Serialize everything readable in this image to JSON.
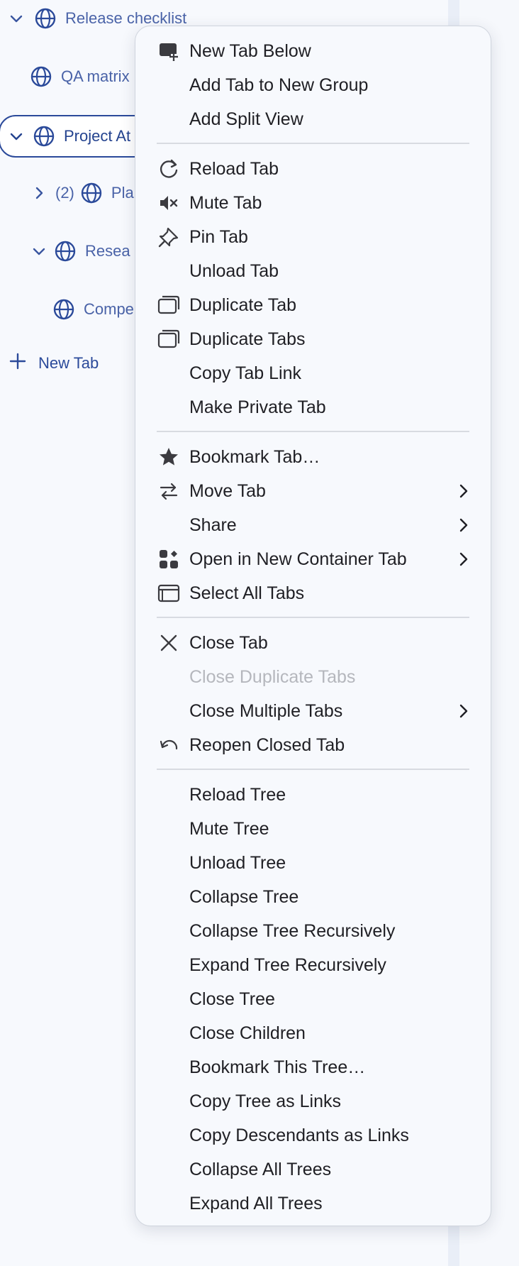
{
  "sidebar": {
    "items": [
      {
        "label": "Release checklist",
        "count": "",
        "expanded": true
      },
      {
        "label": "QA matrix",
        "count": ""
      },
      {
        "label": "Project At",
        "count": "",
        "expanded": true
      },
      {
        "label": "Pla",
        "count": "(2)",
        "expanded": false
      },
      {
        "label": "Resea",
        "count": "",
        "expanded": true
      },
      {
        "label": "Compe",
        "count": ""
      }
    ],
    "new_tab_label": "New Tab"
  },
  "menu": {
    "groups": [
      [
        "New Tab Below",
        "Add Tab to New Group",
        "Add Split View"
      ],
      [
        "Reload Tab",
        "Mute Tab",
        "Pin Tab",
        "Unload Tab",
        "Duplicate Tab",
        "Duplicate Tabs",
        "Copy Tab Link",
        "Make Private Tab"
      ],
      [
        "Bookmark Tab…",
        "Move Tab",
        "Share",
        "Open in New Container Tab",
        "Select All Tabs"
      ],
      [
        "Close Tab",
        "Close Duplicate Tabs",
        "Close Multiple Tabs",
        "Reopen Closed Tab"
      ],
      [
        "Reload Tree",
        "Mute Tree",
        "Unload Tree",
        "Collapse Tree",
        "Collapse Tree Recursively",
        "Expand Tree Recursively",
        "Close Tree",
        "Close Children",
        "Bookmark This Tree…",
        "Copy Tree as Links",
        "Copy Descendants as Links",
        "Collapse All Trees",
        "Expand All Trees"
      ]
    ],
    "disabled_item": "Close Duplicate Tabs",
    "submenu_items": [
      "Move Tab",
      "Share",
      "Open in New Container Tab",
      "Close Multiple Tabs"
    ]
  },
  "icons": {
    "globe": "globe-icon",
    "chevron_down": "chevron-down-icon",
    "chevron_right": "chevron-right-icon",
    "plus": "plus-icon"
  },
  "colors": {
    "accent": "#2b4a9a",
    "link_text": "#4a63a8",
    "menu_text": "#1f1f24",
    "disabled_text": "#b5b7bd",
    "menu_bg": "#f7f9fd"
  }
}
